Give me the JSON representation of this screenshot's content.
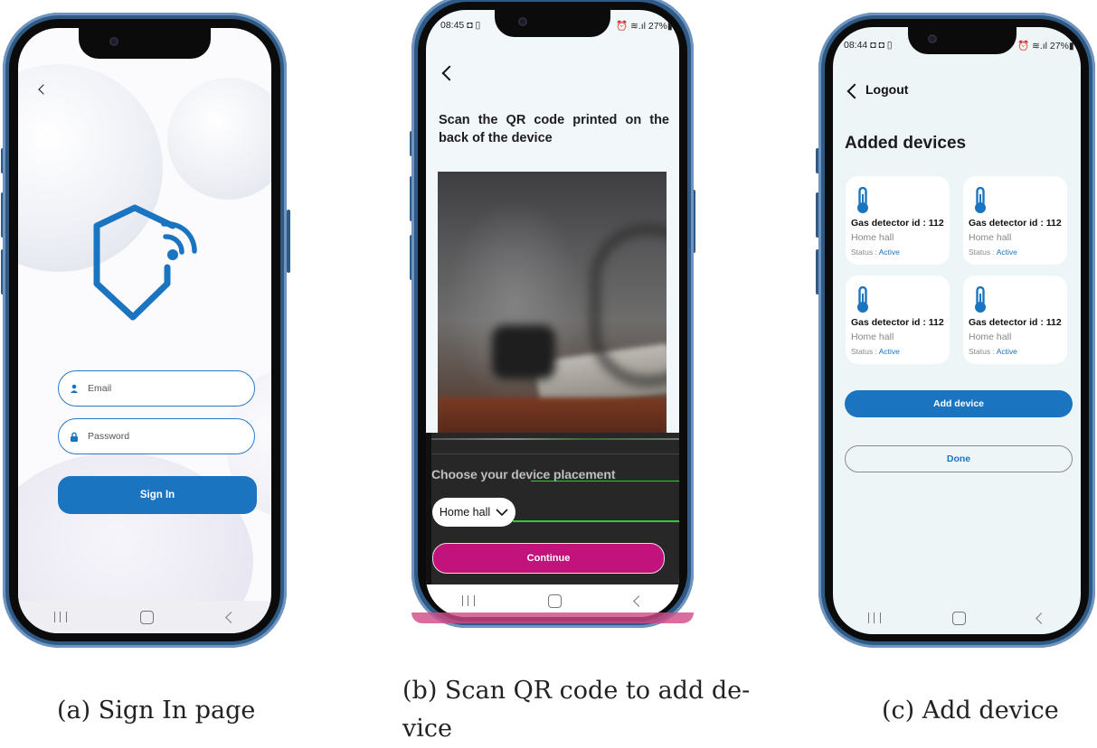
{
  "colors": {
    "primary": "#1a74c0",
    "continue": "#c2127b",
    "status_active": "#1a74c0"
  },
  "signin": {
    "email_placeholder": "Email",
    "password_placeholder": "Password",
    "signin_label": "Sign In",
    "icons": [
      "back-icon",
      "shield-wifi-logo-icon",
      "user-icon",
      "lock-icon"
    ]
  },
  "scan": {
    "time": "08:45",
    "battery": "27%",
    "instruction": "Scan the QR code printed on the back of the device",
    "placement_label": "Choose your device placement",
    "placement_value": "Home hall",
    "continue_label": "Continue"
  },
  "devices": {
    "time": "08:44",
    "battery": "27%",
    "logout_label": "Logout",
    "title": "Added devices",
    "cards": [
      {
        "name": "Gas detector id : 112",
        "location": "Home hall",
        "status_label": "Status : ",
        "status": "Active"
      },
      {
        "name": "Gas detector id : 112",
        "location": "Home hall",
        "status_label": "Status : ",
        "status": "Active"
      },
      {
        "name": "Gas detector id : 112",
        "location": "Home hall",
        "status_label": "Status : ",
        "status": "Active"
      },
      {
        "name": "Gas detector id : 112",
        "location": "Home hall",
        "status_label": "Status : ",
        "status": "Active"
      }
    ],
    "add_label": "Add device",
    "done_label": "Done"
  },
  "captions": {
    "a": "(a) Sign In page",
    "b_line1": "(b) Scan QR code to add de-",
    "b_line2": "vice",
    "c": "(c) Add device"
  }
}
